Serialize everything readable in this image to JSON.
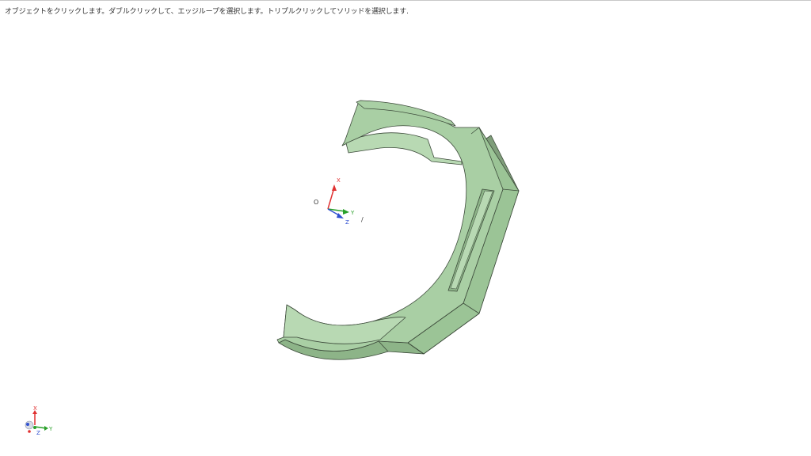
{
  "status_bar": {
    "hint": "オブジェクトをクリックします。ダブルクリックして、エッジループを選択します。トリプルクリックしてソリッドを選択します."
  },
  "model": {
    "name": "curved-bracket-part",
    "face_color": "#a9cfa4",
    "side_color": "#8db488",
    "shadow_color": "#7f9e7a",
    "edge_color": "#3c4a3a"
  },
  "origin_triad": {
    "origin_label": "O",
    "x_label": "X",
    "y_label": "Y",
    "z_label": "Z",
    "extra_label": "/",
    "x_color": "#e03030",
    "y_color": "#2aa02a",
    "z_color": "#3050d0"
  },
  "view_triad": {
    "x_label": "X",
    "y_label": "Y",
    "z_label": "Z",
    "x_color": "#e03030",
    "y_color": "#2aa02a",
    "z_color": "#3050d0"
  }
}
